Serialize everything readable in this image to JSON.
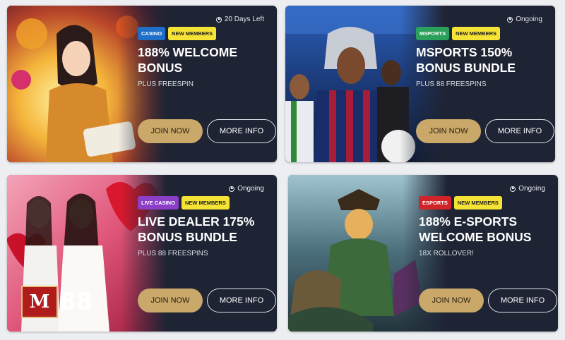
{
  "cards": [
    {
      "status": "20 Days Left",
      "category": "CASINO",
      "category_color": "#1f6fc9",
      "new_tag": "NEW MEMBERS",
      "title": "188% WELCOME BONUS",
      "subtitle": "PLUS FREESPIN",
      "join": "JOIN NOW",
      "more": "MORE INFO"
    },
    {
      "status": "Ongoing",
      "category": "MSPORTS",
      "category_color": "#2aa05a",
      "new_tag": "NEW MEMBERS",
      "title": "MSPORTS 150% BONUS BUNDLE",
      "subtitle": "PLUS 88 FREESPINS",
      "join": "JOIN NOW",
      "more": "MORE INFO"
    },
    {
      "status": "Ongoing",
      "category": "LIVE CASINO",
      "category_color": "#8b3fc7",
      "new_tag": "NEW MEMBERS",
      "title": "LIVE DEALER 175% BONUS BUNDLE",
      "subtitle": "PLUS 88 FREESPINS",
      "join": "JOIN NOW",
      "more": "MORE INFO"
    },
    {
      "status": "Ongoing",
      "category": "ESPORTS",
      "category_color": "#d0242a",
      "new_tag": "NEW MEMBERS",
      "title": "188% E-SPORTS WELCOME BONUS",
      "subtitle": "18X ROLLOVER!",
      "join": "JOIN NOW",
      "more": "MORE INFO"
    }
  ],
  "watermark": {
    "m": "M",
    "n": "88"
  },
  "colors": {
    "card_bg": "#1f2435",
    "join_bg": "#c9a86a",
    "new_tag_bg": "#f5e335"
  }
}
